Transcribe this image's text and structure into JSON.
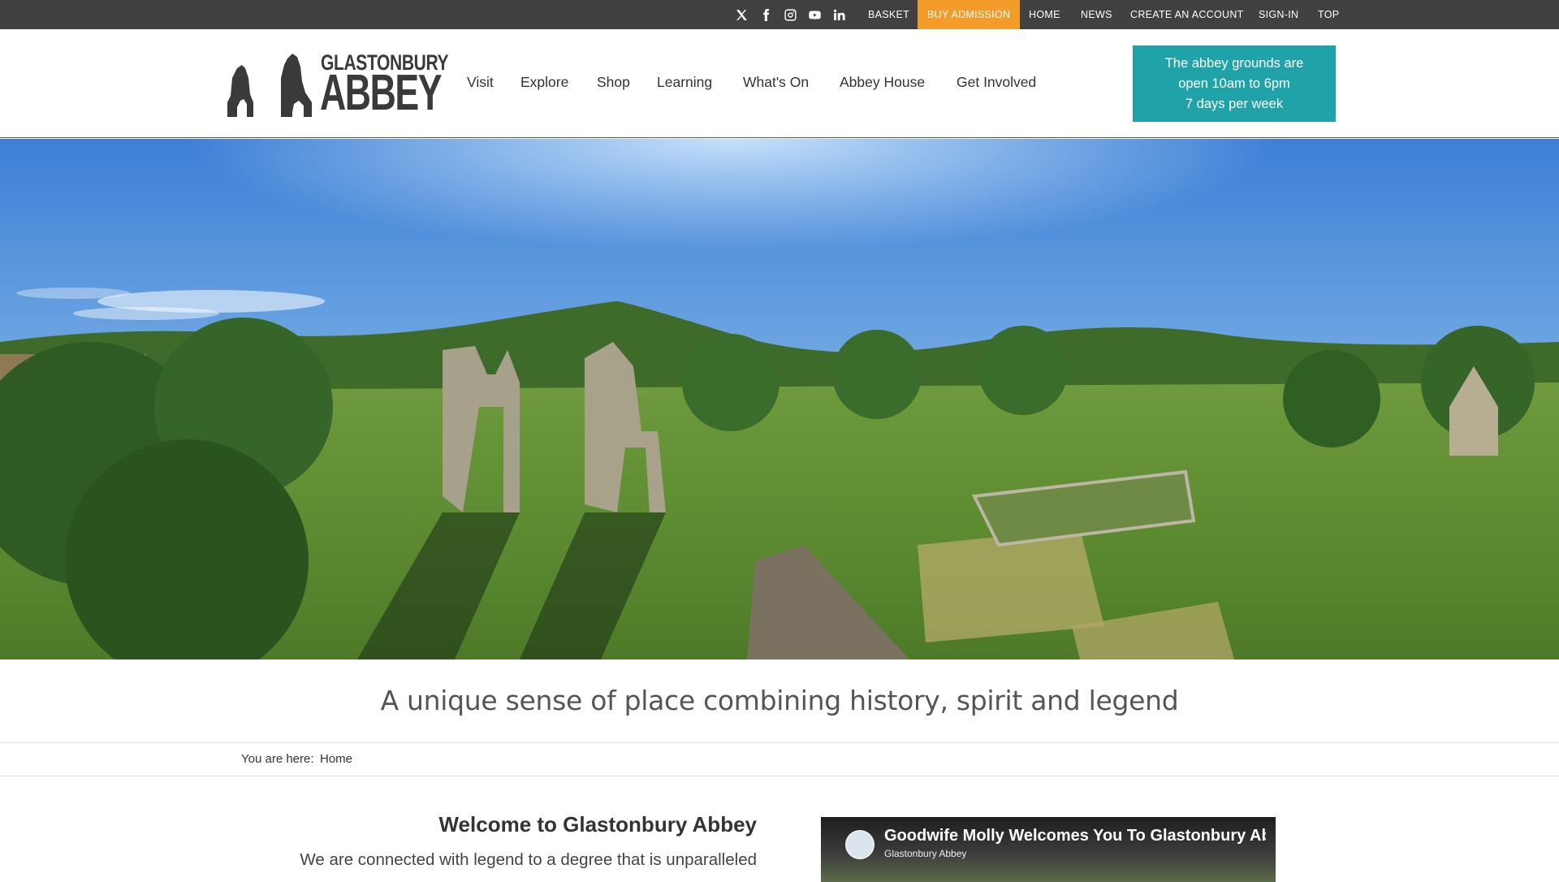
{
  "topbar": {
    "social_icons": [
      "x-twitter-icon",
      "facebook-icon",
      "instagram-icon",
      "youtube-icon",
      "linkedin-icon"
    ],
    "links": {
      "basket": "BASKET",
      "buy_admission": "BUY ADMISSION",
      "home": "HOME",
      "news": "NEWS",
      "create_account": "CREATE AN ACCOUNT",
      "sign_in": "SIGN-IN",
      "top": "TOP"
    }
  },
  "logo": {
    "line1": "GLASTONBURY",
    "line2": "ABBEY"
  },
  "nav": {
    "visit": "Visit",
    "explore": "Explore",
    "shop": "Shop",
    "learning": "Learning",
    "whats_on": "What's On",
    "abbey_house": "Abbey House",
    "get_involved": "Get Involved"
  },
  "hours": {
    "line1": "The abbey grounds are",
    "line2": "open 10am to 6pm",
    "line3": "7 days per week"
  },
  "tagline": "A unique sense of place combining history, spirit and legend",
  "breadcrumb": {
    "label": "You are here:",
    "home": "Home"
  },
  "welcome": {
    "title": "Welcome to Glastonbury Abbey",
    "subtitle": "We are connected with legend to a degree that is unparalleled"
  },
  "video": {
    "title": "Goodwife Molly Welcomes You To Glastonbury Ab",
    "channel": "Glastonbury Abbey"
  },
  "colors": {
    "topbar": "#414141",
    "buy_admission": "#f39c2a",
    "hours_box": "#1fa3a9"
  }
}
